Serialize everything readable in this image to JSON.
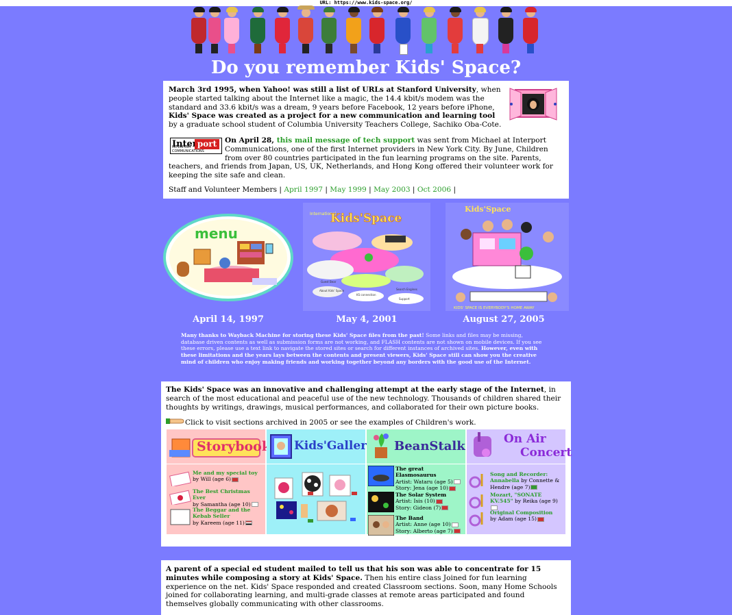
{
  "url_bar": "URL: https://www.kids-space.org/",
  "page_title": "Do you remember Kids' Space?",
  "intro": {
    "p1_bold1": "March 3rd 1995, when Yahoo! was still a list of URLs at Stanford University",
    "p1_text1": ", when people started talking about the Internet like a magic, the 14.4 kbit/s modem was the standard and 33.6 kbit/s was a dream, 9 years before Facebook, 12 years before iPhone, ",
    "p1_bold2": "Kids' Space was created as a project for a new communication and learning tool",
    "p1_text2": " by a graduate school student of Columbia University Teachers College, Sachiko Oba-Cote.",
    "interport_logo_a": "Inter",
    "interport_logo_b": "port",
    "interport_logo_sub": "INTERPORT COMMUNICATIONS",
    "p2_bold": "On April 28, ",
    "p2_link": "this mail message of tech support",
    "p2_text": " was sent from Michael at Interport Communications, one of the first Internet providers in New York City. By June, Children from over 80 countries participated in the fun learning programs on the site. Parents, teachers, and friends from Japan, US, UK, Netherlands, and Hong Kong offered their volunteer work for keeping the site safe and clean.",
    "staff_label": "Staff and Volunteer Members",
    "staff_links": [
      "April 1997",
      "May 1999",
      "May 2003",
      "Oct 2006"
    ]
  },
  "screenshots": [
    {
      "date": "April 14, 1997",
      "caption": "menu"
    },
    {
      "date": "May 4, 2001",
      "caption": "Kids'Space",
      "tiny": "International",
      "labels": [
        "Guest Bear",
        "About Kids' Space",
        "KS connection",
        "Support",
        "Search Engines"
      ]
    },
    {
      "date": "August 27, 2005",
      "caption": "Kids'Space",
      "footer": "KIDS' SPACE IS EVERYBODY'S HOME AWAY"
    }
  ],
  "thanks": {
    "bold_pre": "Many thanks to ",
    "link": "Wayback Machine",
    "bold_post": " for storing these Kids' Space files from the past!",
    "text": " Some links and files may be missing, database driven contents as well as submission forms are not working, and FLASH contents are not shown on mobile devices. If you see these errors, please use a text link to navigate the stored sites or search for different instances of archived sites. ",
    "bold_end": "However, even with these limitations and the years lays between the contents and present viewers, Kids' Space still can show you the creative mind of children who enjoy making friends and working together beyond any borders with the good use of the Internet."
  },
  "section2": {
    "intro_bold": "The Kids' Space was an innovative and challenging attempt at the early stage of the Internet",
    "intro_text": ", in search of the most educational and peaceful use of the new technology. Thousands of children shared their thoughts by writings, drawings, musical performances, and collaborated for their own picture books.",
    "click_text": "Click to visit sections archived in 2005 or see the examples of Children's work."
  },
  "sections": {
    "storybook": {
      "title": "Storybook",
      "items": [
        {
          "title": "Me and my special toy",
          "by": "by Will (age 6)"
        },
        {
          "title": "The Best Christmas Ever",
          "by": "by Samantha (age 10)"
        },
        {
          "title": "The Beggar and the Kebab Seller",
          "by": "by Kareem (age 11)"
        }
      ]
    },
    "gallery": {
      "title": "Kids'Gallery"
    },
    "beanstalk": {
      "title": "BeanStalk",
      "items": [
        {
          "title": "The great Elasmosaurus",
          "artist": "Artist: Wataru (age 5)",
          "story": "Story: Jena (age 10)"
        },
        {
          "title": "The Solar System",
          "artist": "Artist: Isis (10)",
          "story": "Story: Gideon (7)"
        },
        {
          "title": "The Band",
          "artist": "Artist: Anne (age 10)",
          "story": "Story: Alberto (age 7)"
        }
      ]
    },
    "concert": {
      "title_a": "On Air",
      "title_b": "Concert",
      "items": [
        {
          "title": "Song and Recorder: Annabella",
          "by": " by Connette & Hendre (age 7)"
        },
        {
          "title": "Mozart, \"SONATE KV.545\"",
          "by": " by Reika (age 9)"
        },
        {
          "title": "Original Composition",
          "by": " by Adam (age 15)"
        }
      ]
    }
  },
  "section3": {
    "bold": "A parent of a special ed student mailed to tell us that his son was able to concentrate for 15 minutes while composing a story at Kids' Space.",
    "text": " Then his entire class Joined for fun learning experience on the net. Kids' Space responded and created Classroom sections. Soon, many Home Schools joined for collaborating learning, and multi-grade classes at remote areas participated and found themselves globally communicating with other classrooms."
  },
  "colors": {
    "background": "#7b7bff",
    "link": "#2a9d2a",
    "storybook_bg": "#ffc6c6",
    "gallery_bg": "#9ef0f8",
    "beanstalk_bg": "#9ef5c8",
    "concert_bg": "#d4c6ff"
  }
}
